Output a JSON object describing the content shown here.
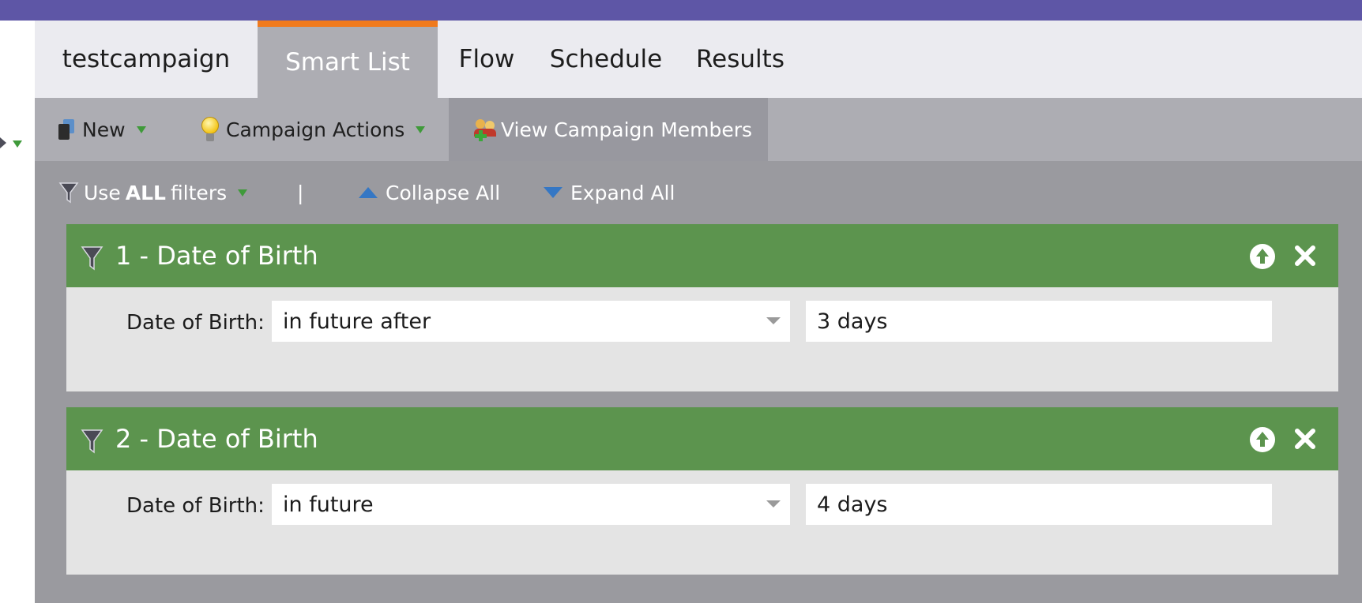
{
  "tabs": [
    {
      "label": "testcampaign",
      "active": false
    },
    {
      "label": "Smart List",
      "active": true
    },
    {
      "label": "Flow",
      "active": false
    },
    {
      "label": "Schedule",
      "active": false
    },
    {
      "label": "Results",
      "active": false
    }
  ],
  "toolbar": {
    "new_label": "New",
    "actions_label": "Campaign Actions",
    "members_label": "View Campaign Members"
  },
  "filterbar": {
    "use_prefix": "Use",
    "use_bold": "ALL",
    "use_suffix": "filters",
    "separator": "|",
    "collapse_label": "Collapse All",
    "expand_label": "Expand All"
  },
  "filters": [
    {
      "title": "1 - Date of Birth",
      "field_label": "Date of Birth:",
      "operator": "in future after",
      "value": "3 days"
    },
    {
      "title": "2 - Date of Birth",
      "field_label": "Date of Birth:",
      "operator": "in future",
      "value": "4 days"
    }
  ],
  "colors": {
    "topbar": "#5e56a6",
    "active_tab_accent": "#f07a1d",
    "filter_header": "#5c944e",
    "dropdown_triangle": "#3f9a3a"
  },
  "icons": {
    "new": "book-icon",
    "actions": "lightbulb-icon",
    "members": "add-people-icon",
    "use_filters": "funnel-icon",
    "collapse": "triangle-up-icon",
    "expand": "triangle-down-icon",
    "move_up": "arrow-up-circle-icon",
    "remove": "close-icon"
  }
}
